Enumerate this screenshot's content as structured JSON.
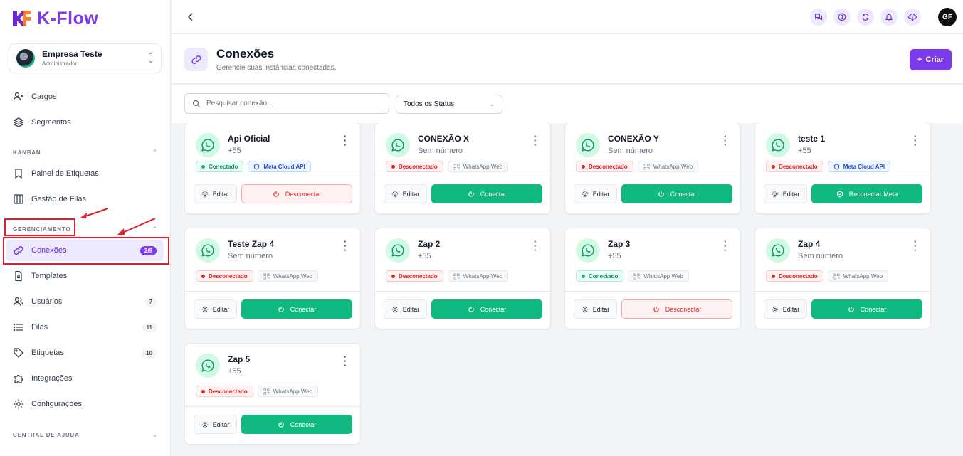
{
  "app": {
    "name": "K-Flow"
  },
  "company": {
    "name": "Empresa Teste",
    "role": "Administrador"
  },
  "sidebar": {
    "top_items": [
      {
        "label": "Cargos"
      },
      {
        "label": "Segmentos"
      }
    ],
    "sections": {
      "kanban": "KANBAN",
      "gerenciamento": "GERENCIAMENTO",
      "ajuda": "CENTRAL DE AJUDA"
    },
    "kanban_items": [
      {
        "label": "Painel de Etiquetas"
      },
      {
        "label": "Gestão de Filas"
      }
    ],
    "manage_items": [
      {
        "label": "Conexões",
        "badge": "2/9"
      },
      {
        "label": "Templates"
      },
      {
        "label": "Usuários",
        "badge": "7"
      },
      {
        "label": "Filas",
        "badge": "11"
      },
      {
        "label": "Etiquetas",
        "badge": "10"
      },
      {
        "label": "Integrações"
      },
      {
        "label": "Configurações"
      }
    ]
  },
  "topbar": {
    "user_initials": "GF"
  },
  "page": {
    "title": "Conexões",
    "subtitle": "Gerencie suas instâncias conectadas.",
    "create_label": "Criar"
  },
  "filters": {
    "search_placeholder": "Pesquisar conexão...",
    "status_selected": "Todos os Status"
  },
  "labels": {
    "edit": "Editar",
    "connect": "Conectar",
    "disconnect": "Desconectar",
    "reconnect_meta": "Reconectar Meta",
    "status_on": "Conectado",
    "status_off": "Desconectado",
    "type_meta": "Meta Cloud API",
    "type_web": "WhatsApp Web"
  },
  "connections": [
    {
      "name": "Api Oficial",
      "number": "+55"
    },
    {
      "name": "CONEXÃO X",
      "number": "Sem número"
    },
    {
      "name": "CONEXÃO Y",
      "number": "Sem número"
    },
    {
      "name": "teste 1",
      "number": "+55"
    },
    {
      "name": "Teste Zap 4",
      "number": "Sem número"
    },
    {
      "name": "Zap 2",
      "number": "+55"
    },
    {
      "name": "Zap 3",
      "number": "+55"
    },
    {
      "name": "Zap 4",
      "number": "Sem número"
    },
    {
      "name": "Zap 5",
      "number": "+55"
    }
  ],
  "colors": {
    "accent": "#7c3aed",
    "success": "#10b981",
    "danger": "#dc2626",
    "annotation": "#e11d2a"
  }
}
